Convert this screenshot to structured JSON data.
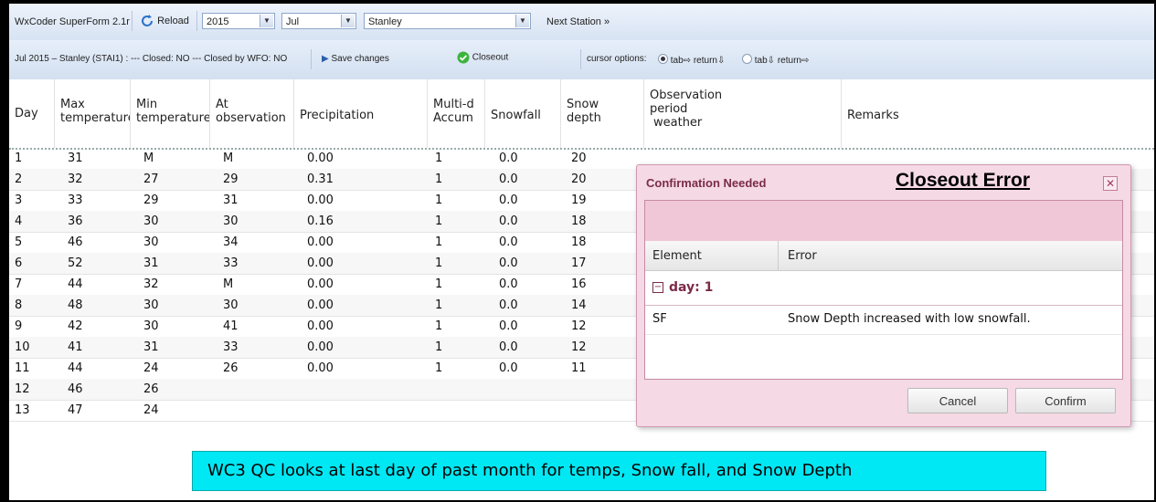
{
  "toolbar": {
    "app_title": "WxCoder SuperForm 2.1r",
    "reload_label": "Reload",
    "year": "2015",
    "month": "Jul",
    "station": "Stanley",
    "next_station_label": "Next Station »"
  },
  "statusbar": {
    "status_text": "Jul 2015 – Stanley (STAI1) : --- Closed: NO --- Closed by WFO: NO",
    "save_label": "Save changes",
    "closeout_label": "Closeout",
    "cursor_label": "cursor options:",
    "opt1": "tab⇨ return⇩",
    "opt2": "tab⇩ return⇨"
  },
  "table": {
    "headers": {
      "day": "Day",
      "max": [
        "Max",
        "temperature"
      ],
      "min": [
        "Min",
        "temperature"
      ],
      "atobs": [
        "At",
        "observation"
      ],
      "precip": "Precipitation",
      "multiday": [
        "Multi-d",
        "Accum"
      ],
      "snowfall": "Snowfall",
      "snowdepth": [
        "Snow",
        "depth"
      ],
      "obsperiod": [
        "Observation",
        "period",
        "weather"
      ],
      "remarks": "Remarks"
    },
    "rows": [
      [
        "1",
        "31",
        "M",
        "M",
        "0.00",
        "1",
        "0.0",
        "20"
      ],
      [
        "2",
        "32",
        "27",
        "29",
        "0.31",
        "1",
        "0.0",
        "20"
      ],
      [
        "3",
        "33",
        "29",
        "31",
        "0.00",
        "1",
        "0.0",
        "19"
      ],
      [
        "4",
        "36",
        "30",
        "30",
        "0.16",
        "1",
        "0.0",
        "18"
      ],
      [
        "5",
        "46",
        "30",
        "34",
        "0.00",
        "1",
        "0.0",
        "18"
      ],
      [
        "6",
        "52",
        "31",
        "33",
        "0.00",
        "1",
        "0.0",
        "17"
      ],
      [
        "7",
        "44",
        "32",
        "M",
        "0.00",
        "1",
        "0.0",
        "16"
      ],
      [
        "8",
        "48",
        "30",
        "30",
        "0.00",
        "1",
        "0.0",
        "14"
      ],
      [
        "9",
        "42",
        "30",
        "41",
        "0.00",
        "1",
        "0.0",
        "12"
      ],
      [
        "10",
        "41",
        "31",
        "33",
        "0.00",
        "1",
        "0.0",
        "12"
      ],
      [
        "11",
        "44",
        "24",
        "26",
        "0.00",
        "1",
        "0.0",
        "11"
      ],
      [
        "12",
        "46",
        "26",
        "",
        "",
        "",
        "",
        ""
      ],
      [
        "13",
        "47",
        "24",
        "",
        "",
        "",
        "",
        ""
      ]
    ]
  },
  "dialog": {
    "title": "Confirmation Needed",
    "overlay_title": "Closeout Error",
    "col_element": "Element",
    "col_error": "Error",
    "group_label": "day: 1",
    "error_element": "SF",
    "error_message": "Snow Depth increased with low snowfall.",
    "cancel_label": "Cancel",
    "confirm_label": "Confirm"
  },
  "annotation": {
    "text": "WC3 QC looks at last day of past month for temps, Snow fall, and Snow Depth"
  },
  "colors": {
    "dialog_bg": "#f5d9e4",
    "dialog_title": "#7a2b49",
    "banner_bg": "#00e8f4"
  }
}
